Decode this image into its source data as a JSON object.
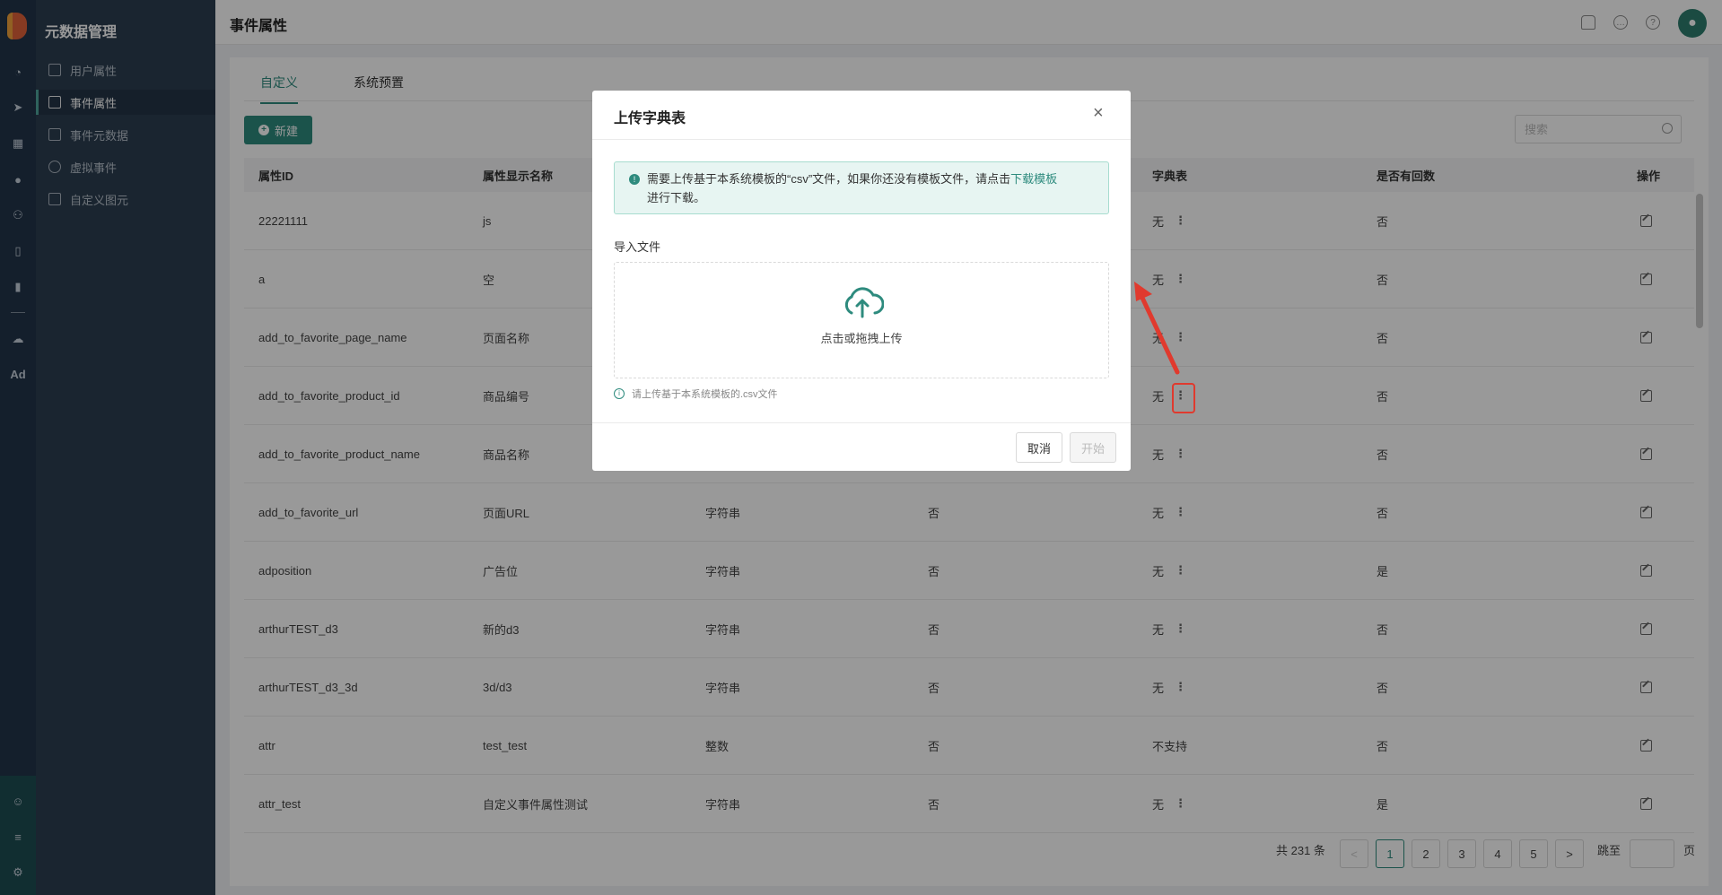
{
  "sidebar": {
    "title": "元数据管理",
    "items": [
      {
        "label": "用户属性",
        "active": false
      },
      {
        "label": "事件属性",
        "active": true
      },
      {
        "label": "事件元数据",
        "active": false
      },
      {
        "label": "虚拟事件",
        "active": false
      },
      {
        "label": "自定义图元",
        "active": false
      }
    ],
    "icons": [
      "dashboard-icon",
      "send-icon",
      "table-icon",
      "user-icon",
      "users-icon",
      "bookmark-icon",
      "bar-chart-icon",
      "wechat-icon",
      "ad-icon",
      "settings-icon"
    ],
    "ad_label": "Ad"
  },
  "header": {
    "title": "事件属性",
    "icons": [
      "bell-icon",
      "message-icon",
      "help-icon"
    ]
  },
  "tabs": [
    {
      "label": "自定义",
      "active": true
    },
    {
      "label": "系统预置",
      "active": false
    }
  ],
  "toolbar": {
    "new_label": "新建",
    "search_placeholder": "搜索"
  },
  "table": {
    "headers": [
      "属性ID",
      "属性显示名称",
      "",
      "",
      "字典表",
      "是否有回数",
      "操作"
    ],
    "rows": [
      {
        "id": "22221111",
        "name": "js",
        "type": "",
        "col4": "",
        "dict": "无",
        "has_return": "否"
      },
      {
        "id": "a",
        "name": "空",
        "type": "",
        "col4": "",
        "dict": "无",
        "has_return": "否"
      },
      {
        "id": "add_to_favorite_page_name",
        "name": "页面名称",
        "type": "",
        "col4": "",
        "dict": "无",
        "has_return": "否"
      },
      {
        "id": "add_to_favorite_product_id",
        "name": "商品编号",
        "type": "",
        "col4": "",
        "dict": "无",
        "has_return": "否"
      },
      {
        "id": "add_to_favorite_product_name",
        "name": "商品名称",
        "type": "",
        "col4": "",
        "dict": "无",
        "has_return": "否"
      },
      {
        "id": "add_to_favorite_url",
        "name": "页面URL",
        "type": "字符串",
        "col4": "否",
        "dict": "无",
        "has_return": "否"
      },
      {
        "id": "adposition",
        "name": "广告位",
        "type": "字符串",
        "col4": "否",
        "dict": "无",
        "has_return": "是"
      },
      {
        "id": "arthurTEST_d3",
        "name": "新的d3",
        "type": "字符串",
        "col4": "否",
        "dict": "无",
        "has_return": "否"
      },
      {
        "id": "arthurTEST_d3_3d",
        "name": "3d/d3",
        "type": "字符串",
        "col4": "否",
        "dict": "无",
        "has_return": "否"
      },
      {
        "id": "attr",
        "name": "test_test",
        "type": "整数",
        "col4": "否",
        "dict": "不支持",
        "has_return": "否"
      },
      {
        "id": "attr_test",
        "name": "自定义事件属性测试",
        "type": "字符串",
        "col4": "否",
        "dict": "无",
        "has_return": "是"
      }
    ]
  },
  "pagination": {
    "total": "共 231 条",
    "prev": "<",
    "next": ">",
    "pages": [
      "1",
      "2",
      "3",
      "4",
      "5"
    ],
    "current": "1",
    "jump_label": "跳至",
    "page_unit": "页"
  },
  "modal": {
    "title": "上传字典表",
    "close": "×",
    "alert_text": "需要上传基于本系统模板的“csv”文件，如果你还没有模板文件，请点击",
    "alert_link": "下载模板",
    "alert_tail": "进行下载。",
    "import_label": "导入文件",
    "upload_text": "点击或拖拽上传",
    "hint": "请上传基于本系统模板的.csv文件",
    "cancel": "取消",
    "start": "开始"
  },
  "colors": {
    "accent": "#2e8b7e",
    "sidebar": "#2c3e50",
    "annotation": "#e03a2e"
  }
}
